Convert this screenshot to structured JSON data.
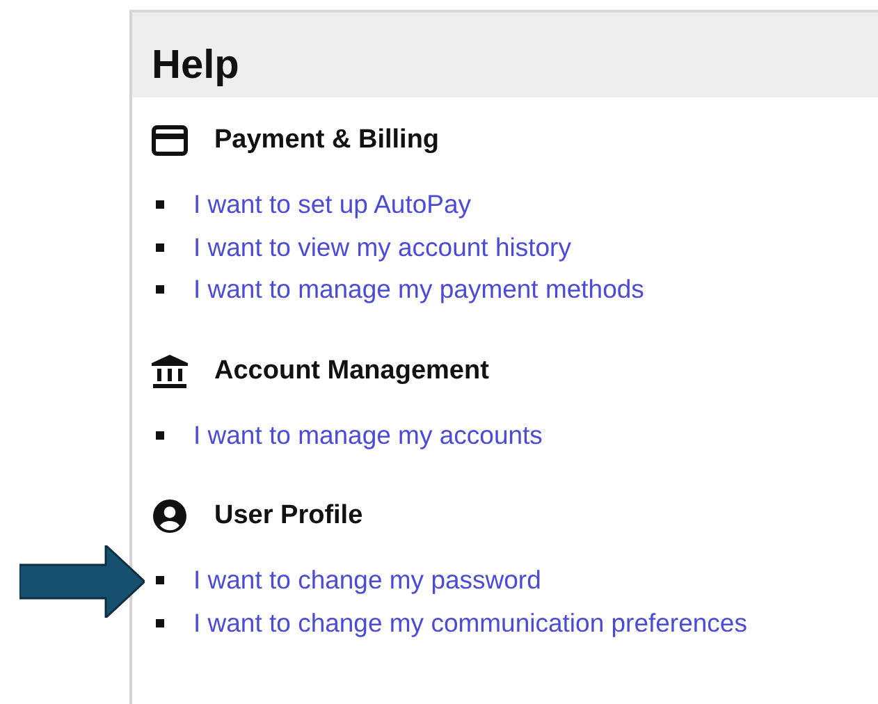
{
  "panel": {
    "title": "Help"
  },
  "sections": [
    {
      "heading": "Payment & Billing",
      "kind": "card",
      "links": [
        {
          "text": "I want to set up AutoPay",
          "pointed": false
        },
        {
          "text": "I want to view my account history",
          "pointed": false
        },
        {
          "text": "I want to manage my payment methods",
          "pointed": false
        }
      ]
    },
    {
      "heading": "Account Management",
      "kind": "bank",
      "links": [
        {
          "text": "I want to manage my accounts",
          "pointed": false
        }
      ]
    },
    {
      "heading": "User Profile",
      "kind": "user",
      "links": [
        {
          "text": "I want to change my password",
          "pointed": true
        },
        {
          "text": "I want to change my communication preferences",
          "pointed": false
        }
      ]
    }
  ]
}
